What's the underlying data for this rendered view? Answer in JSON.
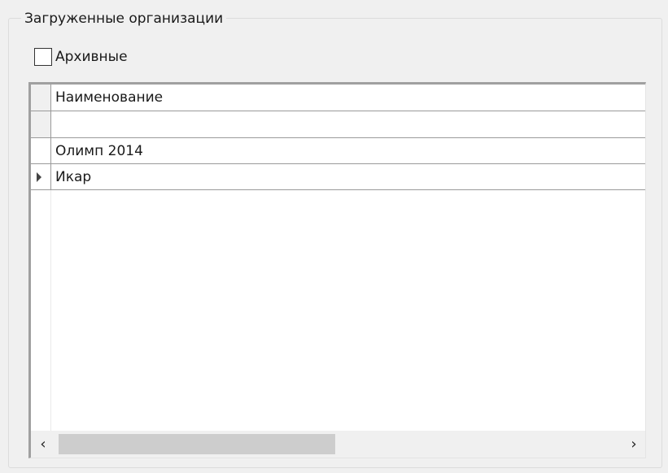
{
  "group": {
    "title": "Загруженные организации"
  },
  "archive_checkbox": {
    "label": "Архивные",
    "checked": false
  },
  "grid": {
    "columns": [
      "Наименование"
    ],
    "filter_value": "",
    "rows": [
      {
        "name": "Олимп 2014",
        "current": false
      },
      {
        "name": "Икар",
        "current": true
      }
    ],
    "scroll_left_glyph": "‹",
    "scroll_right_glyph": "›"
  }
}
